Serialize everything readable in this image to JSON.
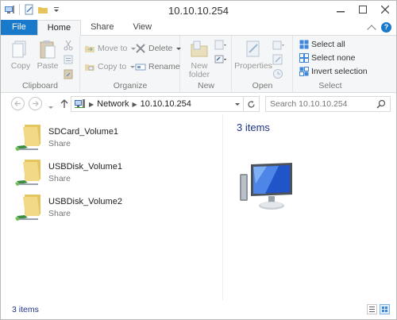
{
  "window": {
    "title": "10.10.10.254"
  },
  "ribbon_tabs": [
    "File",
    "Home",
    "Share",
    "View"
  ],
  "ribbon": {
    "clipboard": {
      "label": "Clipboard",
      "copy": "Copy",
      "paste": "Paste"
    },
    "organize": {
      "label": "Organize",
      "move_to": "Move to",
      "copy_to": "Copy to",
      "delete": "Delete",
      "rename": "Rename"
    },
    "new": {
      "label": "New",
      "new_folder_line1": "New",
      "new_folder_line2": "folder"
    },
    "open": {
      "label": "Open",
      "properties": "Properties"
    },
    "select": {
      "label": "Select",
      "select_all": "Select all",
      "select_none": "Select none",
      "invert_selection": "Invert selection"
    }
  },
  "address": {
    "crumbs": [
      "Network",
      "10.10.10.254"
    ]
  },
  "search": {
    "placeholder": "Search 10.10.10.254"
  },
  "items": [
    {
      "name": "SDCard_Volume1",
      "type": "Share"
    },
    {
      "name": "USBDisk_Volume1",
      "type": "Share"
    },
    {
      "name": "USBDisk_Volume2",
      "type": "Share"
    }
  ],
  "preview": {
    "count_text": "3 items"
  },
  "status": {
    "text": "3 items"
  },
  "colors": {
    "accent": "#1979ca",
    "link_text": "#1e3287",
    "ribbon_bg": "#f5f6f7"
  },
  "icons": {
    "folder": "network-share-folder-icon",
    "computer": "network-computer-icon",
    "network": "network-icon"
  }
}
